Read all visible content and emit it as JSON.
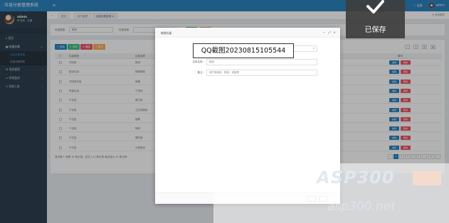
{
  "app": {
    "title": "垃圾分类管理系统",
    "brand_color": "#2c83bf",
    "sidebar_color": "#2f4050"
  },
  "user": {
    "name": "admin",
    "status": "在线",
    "logout": "注销"
  },
  "sidebar": {
    "items": [
      {
        "label": "首页",
        "icon": "home-icon"
      },
      {
        "label": "垃圾分类",
        "icon": "recycle-icon",
        "open": true
      },
      {
        "label": "系统管理",
        "icon": "gear-icon"
      },
      {
        "label": "系统监控",
        "icon": "monitor-icon"
      },
      {
        "label": "系统工具",
        "icon": "tool-icon"
      }
    ],
    "sub_items": [
      {
        "label": "垃圾分类查询",
        "active": true
      },
      {
        "label": "垃圾分类识别"
      }
    ]
  },
  "topbar": {
    "menu_icon": "≡",
    "full_screen": "全屏",
    "user_label": "admin"
  },
  "tabs": {
    "left_arrow": "«",
    "items": [
      {
        "label": "首页"
      },
      {
        "label": "用户管理"
      },
      {
        "label": "垃圾分类查询",
        "active": true
      }
    ],
    "close_others": "关闭操作"
  },
  "filter": {
    "type_label": "垃圾类型：",
    "type_value": "所有",
    "name_label": "垃圾名称："
  },
  "toolbar": {
    "add": "添加",
    "edit": "修改",
    "delete": "删除",
    "export": "导出"
  },
  "table": {
    "headers": [
      "垃圾类型",
      "垃圾名称",
      "操作"
    ],
    "rows": [
      {
        "type": "可回收",
        "name": "报纸"
      },
      {
        "type": "厨余垃圾",
        "name": "剩饭剩菜"
      },
      {
        "type": "可回收垃圾",
        "name": "纸箱"
      },
      {
        "type": "有害垃圾",
        "name": "干电池"
      },
      {
        "type": "干垃圾",
        "name": "餐巾纸"
      },
      {
        "type": "干垃圾",
        "name": "卫生间废纸"
      },
      {
        "type": "干垃圾",
        "name": "烟蒂"
      },
      {
        "type": "干垃圾",
        "name": "陶瓷"
      },
      {
        "type": "干垃圾",
        "name": "塑料袋"
      },
      {
        "type": "干垃圾",
        "name": "污损纸张"
      }
    ],
    "op_edit": "编辑",
    "op_delete": "删除",
    "pager_text": "显示第 1 到第 10 条记录，总共 111 条记录 每页显示 10 条记录",
    "pages": [
      "‹",
      "1",
      "2",
      "3",
      "4",
      "5",
      "…",
      "12",
      "›"
    ]
  },
  "modal": {
    "title": "修改垃圾",
    "controls": [
      "−",
      "⤢",
      "×"
    ],
    "fields": [
      {
        "label": "垃圾类型：",
        "value": ""
      },
      {
        "label": "垃圾名称：",
        "value": "报纸"
      },
      {
        "label": "备注：",
        "value": "请只丢废纸、报纸、纸袋等"
      }
    ]
  },
  "capture_label": "QQ截图20230815105544",
  "saved_toast": {
    "text": "已保存"
  },
  "watermark": {
    "big": "ASP300",
    "small": "asp300.net"
  },
  "colors": {
    "btn_add": "#2c83bf",
    "btn_edit": "#3dbd7d",
    "btn_delete": "#ed5565",
    "btn_export": "#f8ac59",
    "op_edit": "#2c83bf",
    "op_delete": "#ed5565"
  }
}
